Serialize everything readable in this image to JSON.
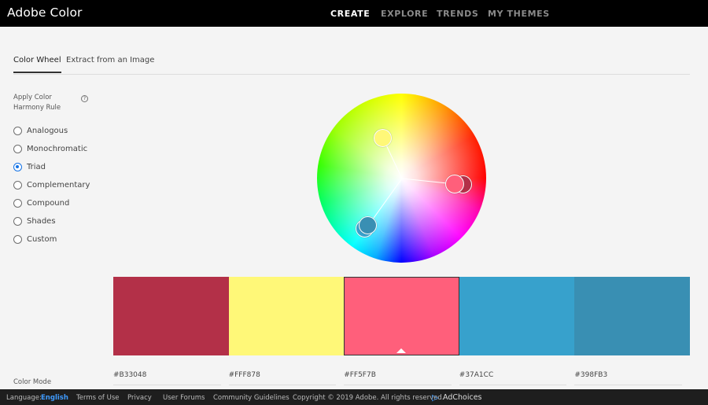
{
  "app": {
    "title": "Adobe Color"
  },
  "nav": {
    "items": [
      "CREATE",
      "EXPLORE",
      "TRENDS",
      "MY THEMES"
    ],
    "active": "CREATE"
  },
  "tabs": {
    "items": [
      "Color Wheel",
      "Extract from an Image"
    ],
    "active": "Color Wheel"
  },
  "harmony": {
    "title": "Apply Color Harmony Rule",
    "info_icon": "info-circle-icon",
    "rules": [
      "Analogous",
      "Monochromatic",
      "Triad",
      "Complementary",
      "Compound",
      "Shades",
      "Custom"
    ],
    "selected": "Triad"
  },
  "colors": {
    "accent": "#1473e6",
    "swatches": [
      {
        "hex_label": "#B33048",
        "color": "#B33048"
      },
      {
        "hex_label": "#FFF878",
        "color": "#FFF878"
      },
      {
        "hex_label": "#FF5F7B",
        "color": "#FF5F7B",
        "selected": true
      },
      {
        "hex_label": "#37A1CC",
        "color": "#37A1CC"
      },
      {
        "hex_label": "#398FB3",
        "color": "#398FB3"
      }
    ]
  },
  "color_mode": {
    "label": "Color Mode"
  },
  "footer": {
    "language_label": "Language:",
    "language_value": "English",
    "links": [
      "Terms of Use",
      "Privacy",
      "User Forums",
      "Community Guidelines"
    ],
    "copyright": "Copyright © 2019 Adobe. All rights reserved.",
    "adchoices": "AdChoices",
    "adchoices_icon": "adchoices-triangle-icon"
  }
}
